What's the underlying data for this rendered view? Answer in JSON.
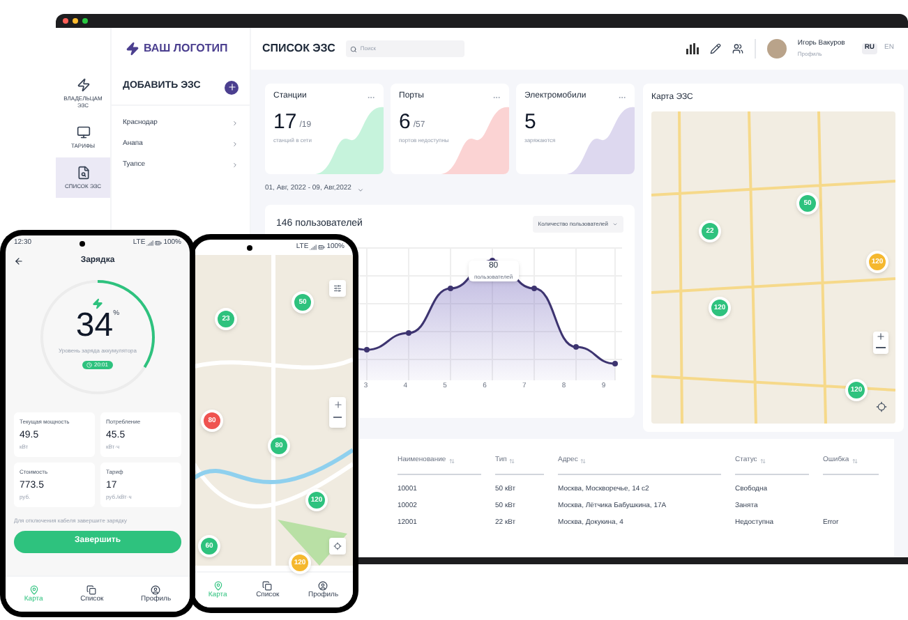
{
  "laptop": {
    "logo": "ВАШ ЛОГОТИП",
    "nav": [
      {
        "label": "ВЛАДЕЛЬЦАМ ЭЗС",
        "selected": false
      },
      {
        "label": "ТАРИФЫ",
        "selected": false
      },
      {
        "label": "СПИСОК ЭЗС",
        "selected": true
      }
    ],
    "add_button": "ДОБАВИТЬ ЭЗС",
    "cities": [
      "Краснодар",
      "Анапа",
      "Туапсе"
    ],
    "page_title": "СПИСОК ЭЗС",
    "search": {
      "placeholder": "Поиск"
    },
    "user": {
      "name": "Игорь Вакуров",
      "subtitle": "Профиль"
    },
    "languages": [
      {
        "label": "RU",
        "selected": true
      },
      {
        "label": "EN",
        "selected": false
      }
    ],
    "stats": [
      {
        "title": "Станции",
        "value": "17",
        "total": "/19",
        "caption": "станций в сети",
        "color": "#c6f3dc"
      },
      {
        "title": "Порты",
        "value": "6",
        "total": "/57",
        "caption": "портов недоступны",
        "color": "#fbd3d3"
      },
      {
        "title": "Электромобили",
        "value": "5",
        "caption": "заряжаются",
        "color": "#ddd8ef"
      }
    ],
    "date_range": "01, Авг, 2022 - 09, Авг,2022",
    "chart": {
      "title": "146 пользователей",
      "metric": "Количество пользователей",
      "x_ticks": [
        "3",
        "4",
        "5",
        "6",
        "7",
        "8",
        "9"
      ],
      "tooltip_value": "80",
      "tooltip_label": "пользователей"
    },
    "map": {
      "title": "Карта ЭЗС",
      "markers": [
        {
          "count": "22",
          "color": "#2ec27e"
        },
        {
          "count": "50",
          "color": "#2ec27e"
        },
        {
          "count": "120",
          "color": "#2ec27e"
        },
        {
          "count": "120",
          "color": "#f5b82e"
        },
        {
          "count": "120",
          "color": "#2ec27e"
        }
      ]
    },
    "table": {
      "columns": [
        "Наименование",
        "Тип",
        "Адрес",
        "Статус",
        "Ошибка"
      ],
      "rows": [
        {
          "name": "10001",
          "type": "50 кВт",
          "address": "Москва, Москворечье, 14 с2",
          "status": "Свободна"
        },
        {
          "name": "10002",
          "type": "50 кВт",
          "address": "Москва, Лётчика Бабушкина, 17А",
          "status": "Занята"
        },
        {
          "name": "12001",
          "type": "22 кВт",
          "address": "Москва, Докукина, 4",
          "status": "Недоступна",
          "error": "Error"
        }
      ]
    }
  },
  "phone_map": {
    "network": "LTE",
    "battery": "100%",
    "markers": [
      {
        "count": "50",
        "color": "#2ec27e"
      },
      {
        "count": "23",
        "color": "#2ec27e"
      },
      {
        "count": "80",
        "color": "#ef5350"
      },
      {
        "count": "80",
        "color": "#2ec27e"
      },
      {
        "count": "120",
        "color": "#2ec27e"
      },
      {
        "count": "60",
        "color": "#2ec27e"
      },
      {
        "count": "120",
        "color": "#f5b82e"
      }
    ],
    "tabs": [
      {
        "label": "Карта",
        "selected": true
      },
      {
        "label": "Список",
        "selected": false
      },
      {
        "label": "Профиль",
        "selected": false
      }
    ]
  },
  "phone_charging": {
    "time": "12:30",
    "network": "LTE",
    "battery": "100%",
    "title": "Зарядка",
    "charge": {
      "value": "34",
      "unit": "%",
      "level": 0.34,
      "caption": "Уровень заряда аккумулятора",
      "timer": "20:01"
    },
    "metrics": [
      {
        "label": "Текущая мощность",
        "value": "49.5",
        "unit": "кВт"
      },
      {
        "label": "Потребление",
        "value": "45.5",
        "unit": "кВт·ч"
      },
      {
        "label": "Стоимость",
        "value": "773.5",
        "unit": "руб."
      },
      {
        "label": "Тариф",
        "value": "17",
        "unit": "руб./кВт·ч"
      }
    ],
    "hint": "Для отключения кабеля завершите зарядку",
    "finish_button": "Завершить",
    "tabs": [
      {
        "label": "Карта",
        "selected": true
      },
      {
        "label": "Список",
        "selected": false
      },
      {
        "label": "Профиль",
        "selected": false
      }
    ]
  }
}
